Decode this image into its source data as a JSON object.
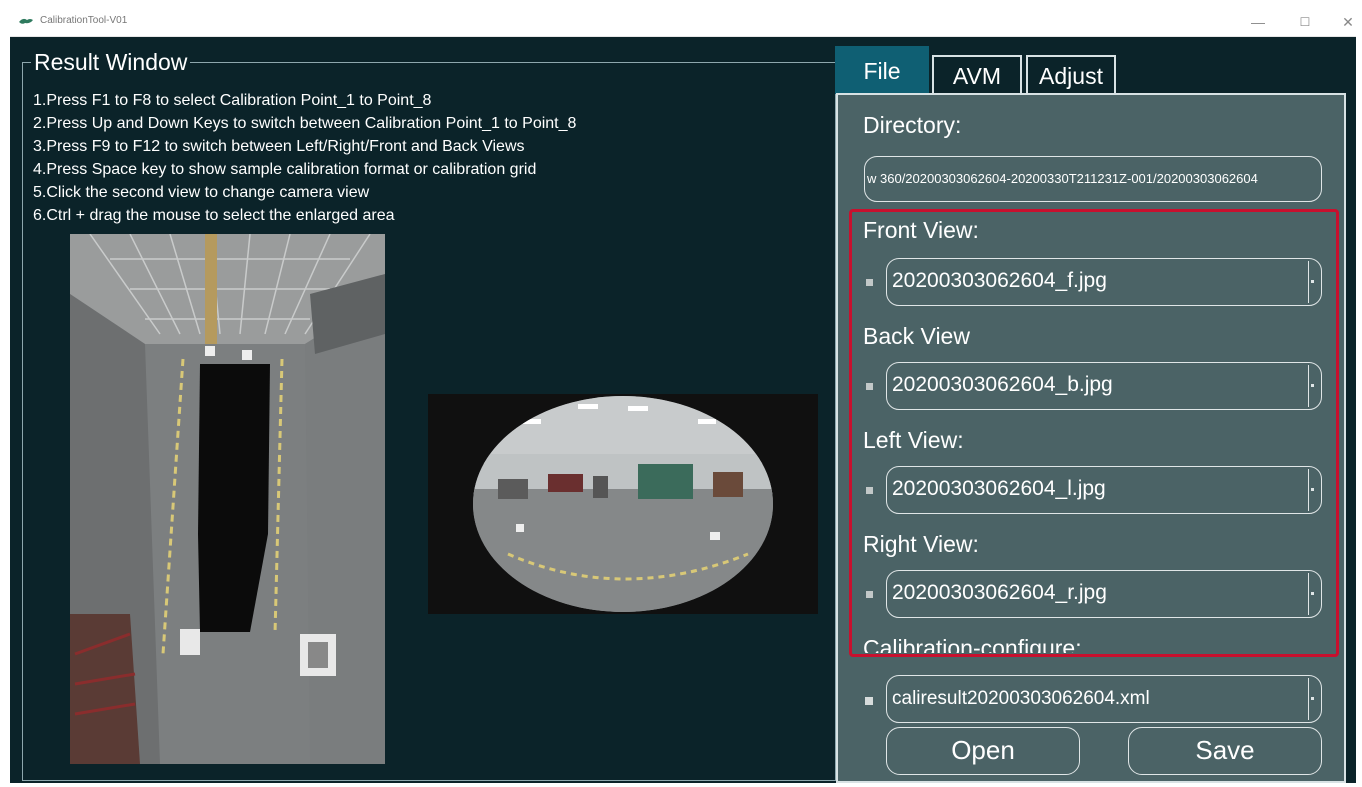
{
  "window": {
    "title": "CalibrationTool-V01",
    "min_glyph": "—",
    "max_glyph": "☐",
    "close_glyph": "✕"
  },
  "result": {
    "title": "Result Window",
    "instructions": [
      "1.Press F1 to F8 to select Calibration Point_1 to Point_8",
      "2.Press Up and Down Keys to switch between Calibration Point_1 to Point_8",
      "3.Press F9 to F12 to switch between Left/Right/Front and Back Views",
      "4.Press Space key to show sample calibration format or calibration grid",
      "5.Click the second view to change camera view",
      "6.Ctrl + drag the mouse to select the enlarged area"
    ]
  },
  "tabs": {
    "file": "File",
    "avm": "AVM",
    "adjust": "Adjust"
  },
  "file_panel": {
    "directory_label": "Directory:",
    "directory_value": "w 360/20200303062604-20200330T211231Z-001/20200303062604",
    "front_label": "Front View:",
    "front_value": "20200303062604_f.jpg",
    "back_label": "Back View",
    "back_value": "20200303062604_b.jpg",
    "left_label": "Left View:",
    "left_value": "20200303062604_l.jpg",
    "right_label": "Right View:",
    "right_value": "20200303062604_r.jpg",
    "calib_label": "Calibration-configure:",
    "calib_value": "caliresult20200303062604.xml",
    "open_button": "Open",
    "save_button": "Save"
  },
  "colors": {
    "background": "#0b2329",
    "panel": "#4b6366",
    "active_tab": "#0f5f73",
    "highlight": "#c8102e"
  }
}
